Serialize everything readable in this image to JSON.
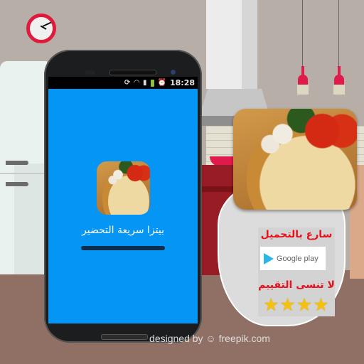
{
  "status_bar": {
    "icons": [
      "sync-icon",
      "wifi-icon",
      "signal-icon",
      "battery-icon",
      "alarm-icon"
    ],
    "time": "18:28"
  },
  "splash": {
    "app_title": "بيتزا سريعة التحضير",
    "progress": 1.0
  },
  "promo": {
    "download_text": "سارع    بالتحميل",
    "store_badge": "Google play",
    "rate_text": "لا   تنسى   التقييم",
    "rating": 4,
    "stars": [
      "★",
      "★",
      "★",
      "★"
    ]
  },
  "credit": "designed by ☺ freepik.com",
  "colors": {
    "screen": "#0596f5",
    "accent_red": "#e8101a",
    "star": "#f4c20d",
    "floor": "#906f64",
    "wall": "#b7aea8"
  }
}
